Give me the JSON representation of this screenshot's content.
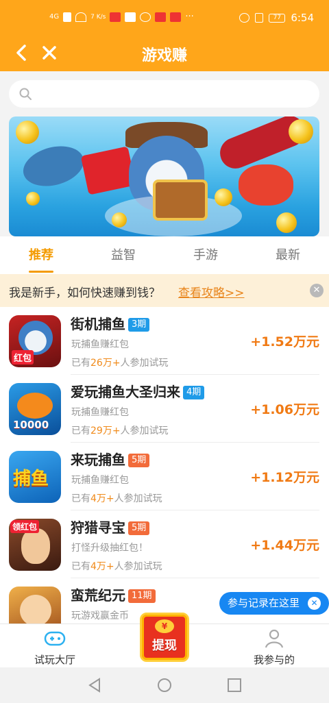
{
  "status_bar": {
    "network": "4G",
    "speed": "7 K/s",
    "time": "6:54",
    "battery": "77"
  },
  "header": {
    "title": "游戏赚"
  },
  "search": {
    "placeholder": ""
  },
  "tabs": [
    {
      "label": "推荐",
      "active": true
    },
    {
      "label": "益智",
      "active": false
    },
    {
      "label": "手游",
      "active": false
    },
    {
      "label": "最新",
      "active": false
    }
  ],
  "notice": {
    "question": "我是新手，如何快速赚到钱？",
    "link": "查看攻略>>"
  },
  "games": [
    {
      "name": "街机捕鱼",
      "badge": "3期",
      "badge_color": "#1f9be8",
      "desc": "玩捕鱼赚红包",
      "players_prefix": "已有",
      "players_count": "26万+",
      "players_suffix": "人参加试玩",
      "reward": "+1.52万元",
      "thumb_text": "红包"
    },
    {
      "name": "爱玩捕鱼大圣归来",
      "badge": "4期",
      "badge_color": "#1f9be8",
      "desc": "玩捕鱼赚红包",
      "players_prefix": "已有",
      "players_count": "29万+",
      "players_suffix": "人参加试玩",
      "reward": "+1.06万元",
      "thumb_text": "10000"
    },
    {
      "name": "来玩捕鱼",
      "badge": "5期",
      "badge_color": "#f26b3a",
      "desc": "玩捕鱼赚红包",
      "players_prefix": "已有",
      "players_count": "4万+",
      "players_suffix": "人参加试玩",
      "reward": "+1.12万元",
      "thumb_text": "捕鱼"
    },
    {
      "name": "狩猎寻宝",
      "badge": "5期",
      "badge_color": "#f26b3a",
      "desc": "打怪升级抽红包！",
      "players_prefix": "已有",
      "players_count": "4万+",
      "players_suffix": "人参加试玩",
      "reward": "+1.44万元",
      "thumb_text": "领红包"
    },
    {
      "name": "蛮荒纪元",
      "badge": "11期",
      "badge_color": "#f26b3a",
      "desc": "玩游戏赢金币",
      "players_prefix": "",
      "players_count": "",
      "players_suffix": "",
      "reward": "",
      "thumb_text": ""
    }
  ],
  "float_pill": {
    "label": "参与记录在这里"
  },
  "bottom_nav": {
    "left": "试玩大厅",
    "center": "提现",
    "center_coin": "¥",
    "right": "我参与的"
  }
}
